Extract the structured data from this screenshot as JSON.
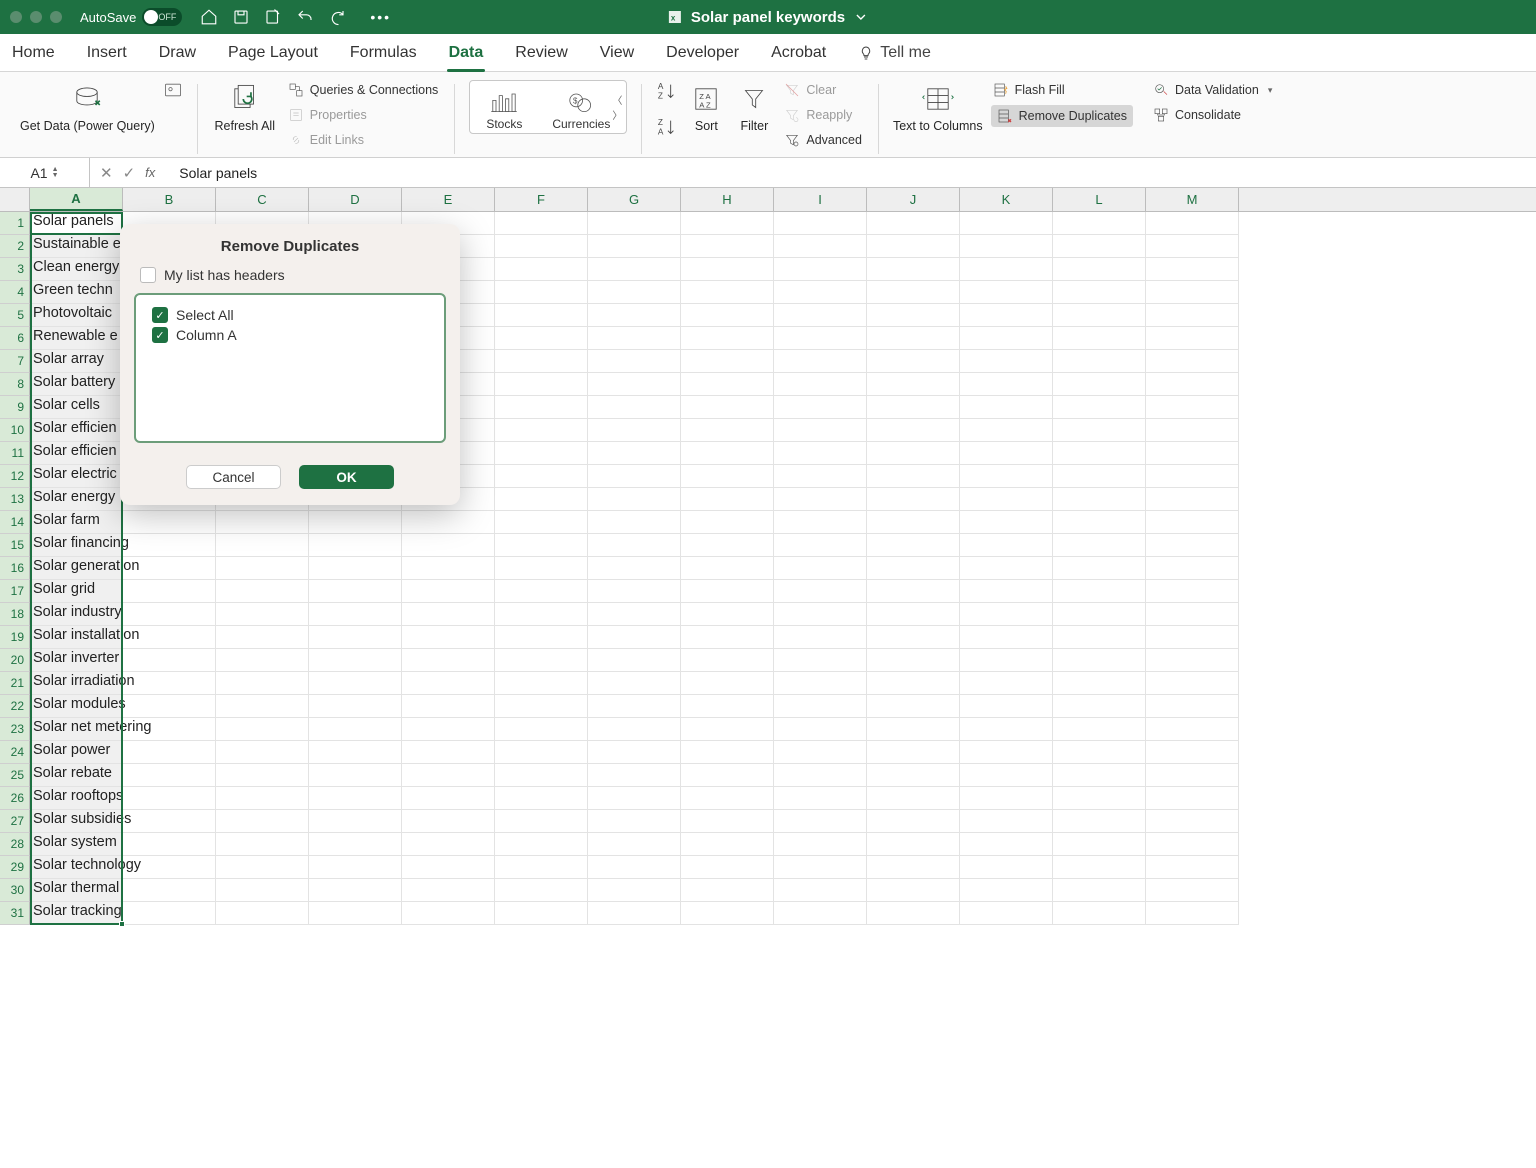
{
  "titlebar": {
    "autosave_label": "AutoSave",
    "autosave_state": "OFF",
    "document_title": "Solar panel keywords"
  },
  "tabs": {
    "items": [
      "Home",
      "Insert",
      "Draw",
      "Page Layout",
      "Formulas",
      "Data",
      "Review",
      "View",
      "Developer",
      "Acrobat"
    ],
    "active_index": 5,
    "tellme": "Tell me"
  },
  "ribbon": {
    "get_data": "Get Data (Power Query)",
    "refresh_all": "Refresh All",
    "qc": "Queries & Connections",
    "properties": "Properties",
    "edit_links": "Edit Links",
    "stocks": "Stocks",
    "currencies": "Currencies",
    "sort": "Sort",
    "filter": "Filter",
    "clear": "Clear",
    "reapply": "Reapply",
    "advanced": "Advanced",
    "text_to_cols": "Text to Columns",
    "flash_fill": "Flash Fill",
    "remove_dup": "Remove Duplicates",
    "data_validation": "Data Validation",
    "consolidate": "Consolidate"
  },
  "formula_bar": {
    "cell_ref": "A1",
    "fx": "fx",
    "value": "Solar panels"
  },
  "columns": [
    "A",
    "B",
    "C",
    "D",
    "E",
    "F",
    "G",
    "H",
    "I",
    "J",
    "K",
    "L",
    "M"
  ],
  "rows": [
    1,
    2,
    3,
    4,
    5,
    6,
    7,
    8,
    9,
    10,
    11,
    12,
    13,
    14,
    15,
    16,
    17,
    18,
    19,
    20,
    21,
    22,
    23,
    24,
    25,
    26,
    27,
    28,
    29,
    30,
    31
  ],
  "col_a": [
    "Solar panels",
    "Sustainable e",
    "Clean energy",
    "Green techn",
    "Photovoltaic",
    "Renewable e",
    "Solar array",
    "Solar battery",
    "Solar cells",
    "Solar efficien",
    "Solar efficien",
    "Solar electric",
    "Solar energy",
    "Solar farm",
    "Solar financing",
    "Solar generation",
    "Solar grid",
    "Solar industry",
    "Solar installation",
    "Solar inverter",
    "Solar irradiation",
    "Solar modules",
    "Solar net metering",
    "Solar power",
    "Solar rebate",
    "Solar rooftops",
    "Solar subsidies",
    "Solar system",
    "Solar technology",
    "Solar thermal",
    "Solar tracking"
  ],
  "dialog": {
    "title": "Remove Duplicates",
    "headers_label": "My list has headers",
    "select_all": "Select All",
    "column_a": "Column A",
    "cancel": "Cancel",
    "ok": "OK"
  }
}
